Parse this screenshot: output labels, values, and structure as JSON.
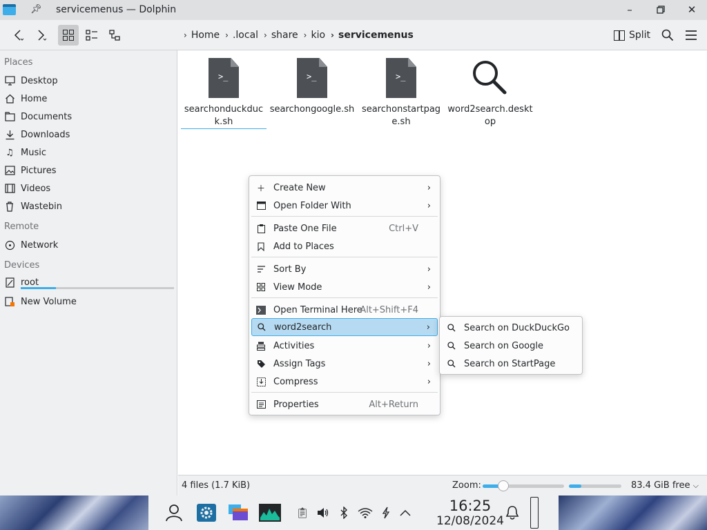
{
  "window": {
    "title": "servicemenus — Dolphin"
  },
  "breadcrumb": [
    "Home",
    ".local",
    "share",
    "kio",
    "servicemenus"
  ],
  "toolbar": {
    "split_label": "Split"
  },
  "sidebar": {
    "places_heading": "Places",
    "places": [
      {
        "label": "Desktop",
        "icon": "desktop-icon"
      },
      {
        "label": "Home",
        "icon": "home-icon"
      },
      {
        "label": "Documents",
        "icon": "documents-icon"
      },
      {
        "label": "Downloads",
        "icon": "downloads-icon"
      },
      {
        "label": "Music",
        "icon": "music-icon"
      },
      {
        "label": "Pictures",
        "icon": "pictures-icon"
      },
      {
        "label": "Videos",
        "icon": "videos-icon"
      },
      {
        "label": "Wastebin",
        "icon": "wastebin-icon"
      }
    ],
    "remote_heading": "Remote",
    "remote": [
      {
        "label": "Network",
        "icon": "network-icon"
      }
    ],
    "devices_heading": "Devices",
    "devices": [
      {
        "label": "root",
        "icon": "drive-icon",
        "usage_fraction": 0.23
      },
      {
        "label": "New Volume",
        "icon": "drive-usb-icon"
      }
    ]
  },
  "files": [
    {
      "name": "searchonduckduck.sh",
      "type": "script"
    },
    {
      "name": "searchongoogle.sh",
      "type": "script"
    },
    {
      "name": "searchonstartpage.sh",
      "type": "script"
    },
    {
      "name": "word2search.desktop",
      "type": "search"
    }
  ],
  "status": {
    "summary": "4 files (1.7 KiB)",
    "zoom_label": "Zoom:",
    "free_label": "83.4 GiB free",
    "zoom_fraction": 0.25,
    "used_fraction": 0.24
  },
  "context_menu": {
    "items": [
      {
        "label": "Create New",
        "shortcut": "",
        "submenu": true,
        "icon": "plus-icon"
      },
      {
        "label": "Open Folder With",
        "shortcut": "",
        "submenu": true,
        "icon": "open-with-icon"
      },
      {
        "label": "Paste One File",
        "shortcut": "Ctrl+V",
        "submenu": false,
        "icon": "paste-icon"
      },
      {
        "label": "Add to Places",
        "shortcut": "",
        "submenu": false,
        "icon": "bookmark-icon"
      },
      {
        "label": "Sort By",
        "shortcut": "",
        "submenu": true,
        "icon": "sort-icon"
      },
      {
        "label": "View Mode",
        "shortcut": "",
        "submenu": true,
        "icon": "view-mode-icon"
      },
      {
        "label": "Open Terminal Here",
        "shortcut": "Alt+Shift+F4",
        "submenu": false,
        "icon": "terminal-icon"
      },
      {
        "label": "word2search",
        "shortcut": "",
        "submenu": true,
        "icon": "search-icon"
      },
      {
        "label": "Activities",
        "shortcut": "",
        "submenu": true,
        "icon": "activities-icon"
      },
      {
        "label": "Assign Tags",
        "shortcut": "",
        "submenu": true,
        "icon": "tag-icon"
      },
      {
        "label": "Compress",
        "shortcut": "",
        "submenu": true,
        "icon": "compress-icon"
      },
      {
        "label": "Properties",
        "shortcut": "Alt+Return",
        "submenu": false,
        "icon": "properties-icon"
      }
    ]
  },
  "submenu": {
    "items": [
      {
        "label": "Search on DuckDuckGo",
        "icon": "search-icon"
      },
      {
        "label": "Search on Google",
        "icon": "search-icon"
      },
      {
        "label": "Search on StartPage",
        "icon": "search-icon"
      }
    ]
  },
  "taskbar": {
    "time": "16:25",
    "date": "12/08/2024"
  }
}
